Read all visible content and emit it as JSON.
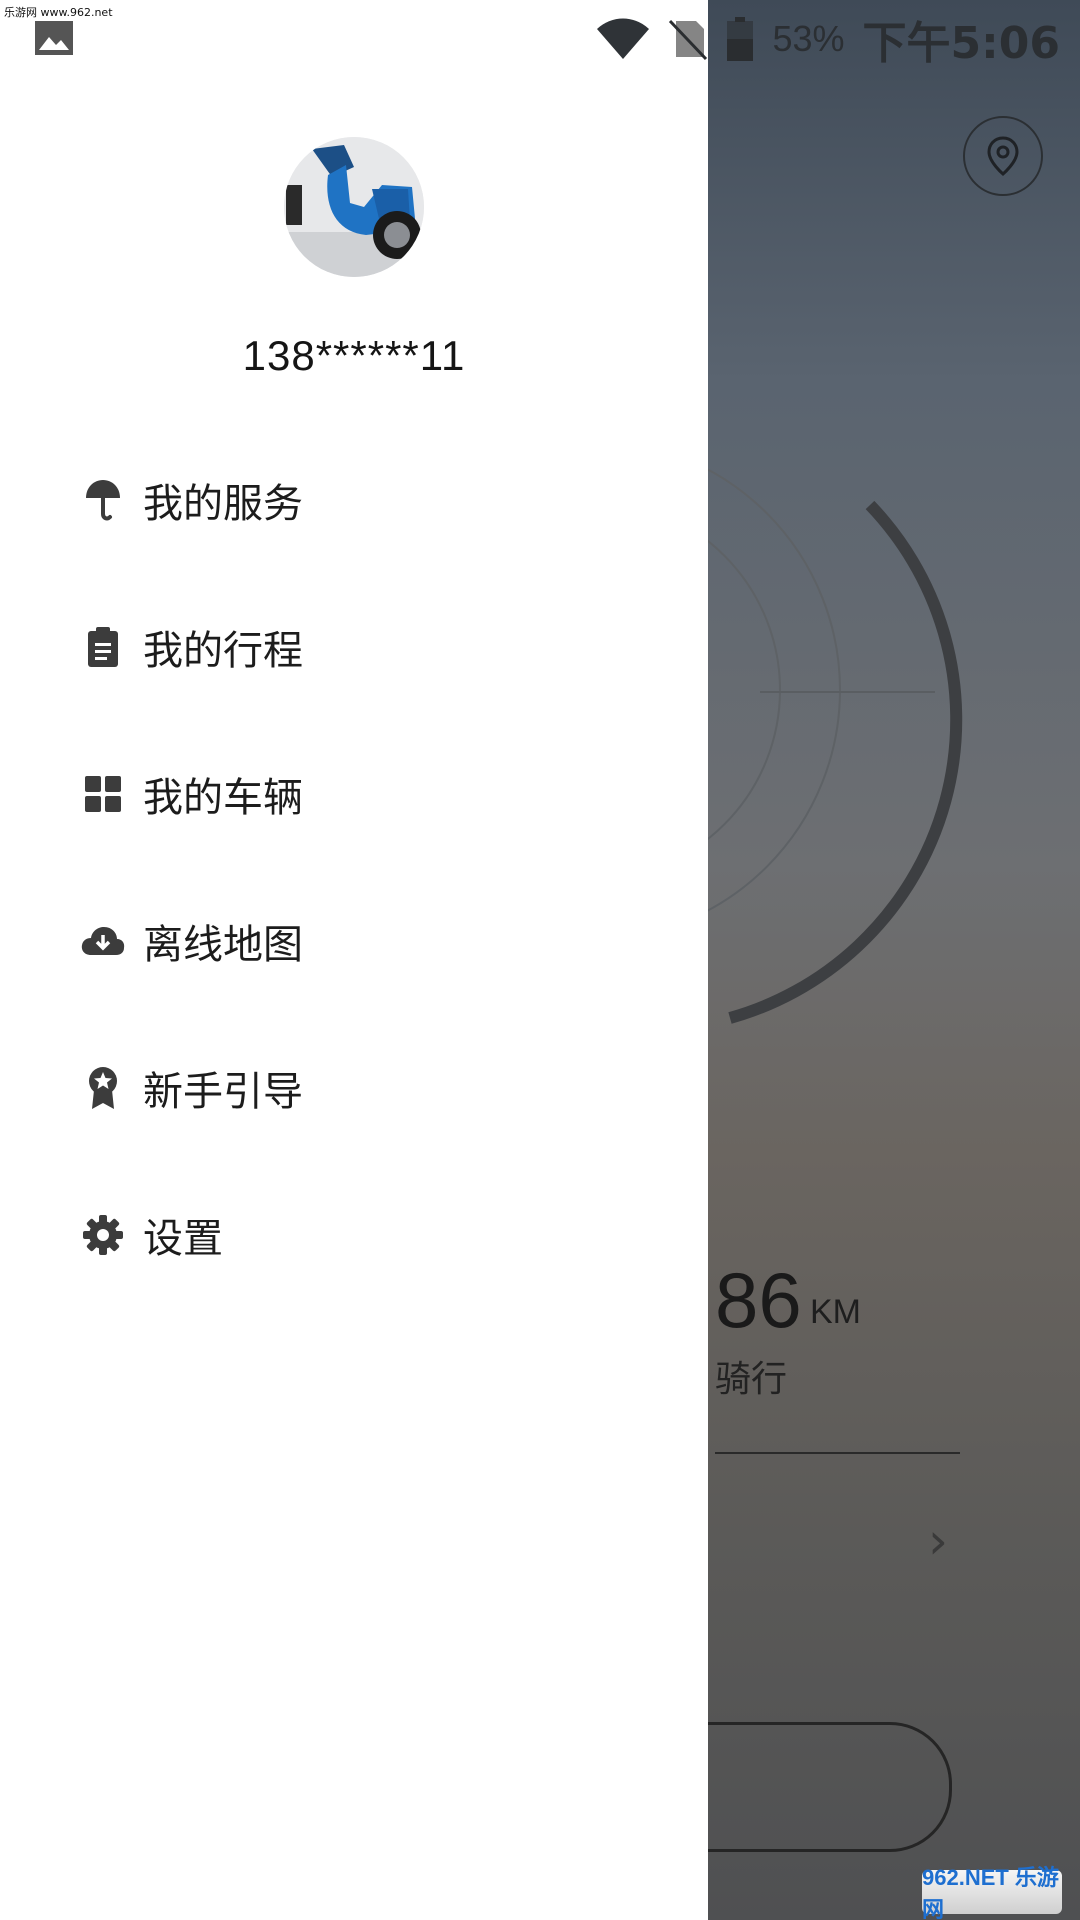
{
  "status_bar": {
    "watermark": "乐游网 www.962.net",
    "battery_percent": "53%",
    "time": "下午5:06"
  },
  "drawer": {
    "phone": "138******11",
    "menu": [
      {
        "label": "我的服务",
        "icon": "umbrella-icon"
      },
      {
        "label": "我的行程",
        "icon": "clipboard-icon"
      },
      {
        "label": "我的车辆",
        "icon": "grid-icon"
      },
      {
        "label": "离线地图",
        "icon": "cloud-download-icon"
      },
      {
        "label": "新手引导",
        "icon": "badge-icon"
      },
      {
        "label": "设置",
        "icon": "gear-icon"
      }
    ]
  },
  "background": {
    "distance": "86",
    "distance_unit": "KM",
    "ride_label": "骑行"
  },
  "corner_logo": "962.NET 乐游网"
}
